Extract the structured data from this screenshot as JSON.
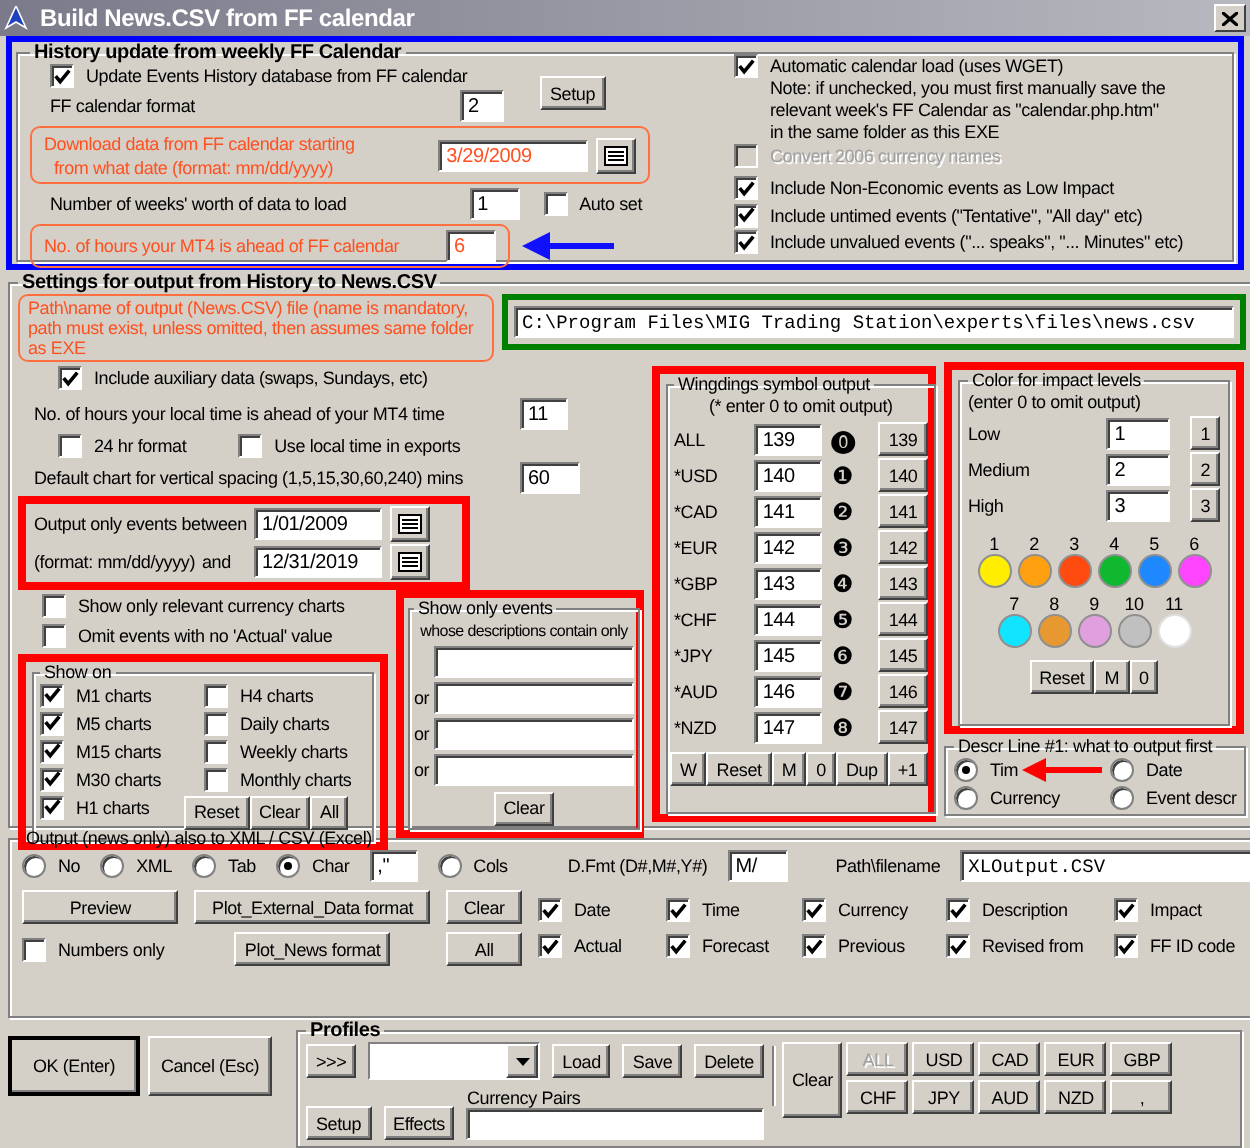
{
  "window": {
    "title": "Build News.CSV from FF calendar"
  },
  "history": {
    "title": "History update from weekly FF Calendar",
    "update_events": {
      "label": "Update Events History database from FF calendar",
      "checked": true
    },
    "setup_button": "Setup",
    "format": {
      "label": "FF calendar format",
      "value": "2"
    },
    "download": {
      "label_lines": [
        "Download data from FF calendar starting",
        "from what date (format: mm/dd/yyyy)"
      ],
      "value": "3/29/2009"
    },
    "weeks": {
      "label": "Number of weeks' worth of data to load",
      "value": "1"
    },
    "auto_set": {
      "label": "Auto set",
      "checked": false
    },
    "hours_ahead": {
      "label": "No. of hours your MT4 is ahead of FF calendar",
      "value": "6"
    },
    "auto_load": {
      "label": "Automatic calendar load  (uses WGET)",
      "checked": true
    },
    "note_lines": [
      "Note: if unchecked, you must first manually save the",
      "relevant week's FF Calendar as \"calendar.php.htm\"",
      "in the same folder as this EXE"
    ],
    "options": [
      {
        "label": "Convert 2006 currency names",
        "checked": false,
        "disabled": true
      },
      {
        "label": "Include Non-Economic events as Low Impact",
        "checked": true,
        "disabled": false
      },
      {
        "label": "Include untimed events (\"Tentative\", \"All day\" etc)",
        "checked": true,
        "disabled": false
      },
      {
        "label": "Include unvalued events (\"... speaks\", \"... Minutes\" etc)",
        "checked": true,
        "disabled": false
      }
    ]
  },
  "output_settings": {
    "title": "Settings for output from History to News.CSV",
    "path_hint": "Path\\name of output (News.CSV) file  (name is mandatory, path must exist, unless omitted, then assumes same folder as EXE",
    "path": "C:\\Program Files\\MIG Trading Station\\experts\\files\\news.csv",
    "auxiliary": {
      "label": "Include auxiliary data (swaps, Sundays, etc)",
      "checked": true
    },
    "local_hours": {
      "label": "No. of hours your local time is ahead of your MT4 time",
      "value": "11"
    },
    "format_24hr": {
      "label": "24 hr format",
      "checked": false
    },
    "local_exports": {
      "label": "Use local time in exports",
      "checked": false
    },
    "spacing": {
      "label": "Default chart for vertical spacing  (1,5,15,30,60,240)  mins",
      "value": "60"
    },
    "events_between": {
      "label_lines": [
        "Output only events between",
        "(format: mm/dd/yyyy)"
      ],
      "and_label": "and",
      "from": "1/01/2009",
      "to": "12/31/2019"
    },
    "relevant_only": {
      "label": "Show only relevant currency charts",
      "checked": false
    },
    "omit_no_actual": {
      "label": "Omit events with no 'Actual' value",
      "checked": false
    },
    "show_on": {
      "title": "Show on",
      "charts": [
        {
          "label": "M1 charts",
          "checked": true
        },
        {
          "label": "M5 charts",
          "checked": true
        },
        {
          "label": "M15 charts",
          "checked": true
        },
        {
          "label": "M30 charts",
          "checked": true
        },
        {
          "label": "H1 charts",
          "checked": true
        },
        {
          "label": "H4 charts",
          "checked": false
        },
        {
          "label": "Daily charts",
          "checked": false
        },
        {
          "label": "Weekly charts",
          "checked": false
        },
        {
          "label": "Monthly charts",
          "checked": false
        }
      ],
      "buttons": [
        "Reset",
        "Clear",
        "All"
      ]
    },
    "desc_filter": {
      "title_lines": [
        "Show only events",
        "whose descriptions contain only"
      ],
      "fields": [
        {
          "kind": "first"
        },
        {
          "kind": "or",
          "label": "or"
        },
        {
          "kind": "or",
          "label": "or"
        },
        {
          "kind": "or",
          "label": "or"
        }
      ],
      "button": "Clear"
    },
    "wingdings": {
      "title": "Wingdings symbol output",
      "note": "(* enter 0 to omit output)",
      "rows": [
        {
          "currency": "ALL",
          "value": "139",
          "glyph": "⓿",
          "button": "139"
        },
        {
          "currency": "*USD",
          "value": "140",
          "glyph": "❶",
          "button": "140"
        },
        {
          "currency": "*CAD",
          "value": "141",
          "glyph": "❷",
          "button": "141"
        },
        {
          "currency": "*EUR",
          "value": "142",
          "glyph": "❸",
          "button": "142"
        },
        {
          "currency": "*GBP",
          "value": "143",
          "glyph": "❹",
          "button": "143"
        },
        {
          "currency": "*CHF",
          "value": "144",
          "glyph": "❺",
          "button": "144"
        },
        {
          "currency": "*JPY",
          "value": "145",
          "glyph": "❻",
          "button": "145"
        },
        {
          "currency": "*AUD",
          "value": "146",
          "glyph": "❼",
          "button": "146"
        },
        {
          "currency": "*NZD",
          "value": "147",
          "glyph": "❽",
          "button": "147"
        }
      ],
      "buttons": [
        "W",
        "Reset",
        "M",
        "0",
        "Dup",
        "+1"
      ]
    },
    "impact_colors": {
      "title": "Color for impact levels",
      "note": "(enter 0 to omit output)",
      "levels": [
        {
          "label": "Low",
          "value": "1",
          "button": "1"
        },
        {
          "label": "Medium",
          "value": "2",
          "button": "2"
        },
        {
          "label": "High",
          "value": "3",
          "button": "3"
        }
      ],
      "swatches": [
        {
          "label": "1",
          "color": "#ffee00"
        },
        {
          "label": "2",
          "color": "#ffa010"
        },
        {
          "label": "3",
          "color": "#ff4a10"
        },
        {
          "label": "4",
          "color": "#10b830"
        },
        {
          "label": "5",
          "color": "#1e88ff"
        },
        {
          "label": "6",
          "color": "#ff44ff"
        },
        {
          "label": "7",
          "color": "#10e4ff"
        },
        {
          "label": "8",
          "color": "#e89830"
        },
        {
          "label": "9",
          "color": "#e0a0e0"
        },
        {
          "label": "10",
          "color": "#c0c0c0"
        },
        {
          "label": "11",
          "color": "#ffffff"
        }
      ],
      "buttons": [
        "Reset",
        "M",
        "0"
      ]
    },
    "descr_line": {
      "title": "Descr Line #1: what to output first",
      "options": [
        {
          "label": "Tim",
          "selected": true
        },
        {
          "label": "Date",
          "selected": false
        },
        {
          "label": "Currency",
          "selected": false
        },
        {
          "label": "Event descr",
          "selected": false
        }
      ]
    }
  },
  "export": {
    "title": "Output (news only) also to XML / CSV (Excel)",
    "formats": [
      {
        "label": "No",
        "selected": false
      },
      {
        "label": "XML",
        "selected": false
      },
      {
        "label": "Tab",
        "selected": false
      },
      {
        "label": "Char",
        "selected": true
      },
      {
        "label": "Cols",
        "selected": false
      }
    ],
    "char_value": ",\"",
    "date_format": {
      "label": "D.Fmt (D#,M#,Y#)",
      "value": "M/"
    },
    "path": {
      "label": "Path\\filename",
      "value": "XLOutput.CSV"
    },
    "preview_button": "Preview",
    "plot_external_button": "Plot_External_Data format",
    "clear_button": "Clear",
    "numbers_only": {
      "label": "Numbers only",
      "checked": false
    },
    "plot_news_button": "Plot_News format",
    "all_button": "All",
    "fields": [
      {
        "label": "Date",
        "checked": true
      },
      {
        "label": "Time",
        "checked": true
      },
      {
        "label": "Currency",
        "checked": true
      },
      {
        "label": "Description",
        "checked": true
      },
      {
        "label": "Impact",
        "checked": true
      },
      {
        "label": "Actual",
        "checked": true
      },
      {
        "label": "Forecast",
        "checked": true
      },
      {
        "label": "Previous",
        "checked": true
      },
      {
        "label": "Revised from",
        "checked": true
      },
      {
        "label": "FF ID code",
        "checked": true
      }
    ]
  },
  "footer": {
    "ok_button": "OK (Enter)",
    "cancel_button": "Cancel (Esc)",
    "profiles": {
      "title": "Profiles",
      "expand_button": ">>>",
      "load_button": "Load",
      "save_button": "Save",
      "delete_button": "Delete",
      "clear_button": "Clear",
      "currencies": [
        {
          "label": "ALL",
          "disabled": true
        },
        {
          "label": "USD",
          "disabled": false
        },
        {
          "label": "CAD",
          "disabled": false
        },
        {
          "label": "EUR",
          "disabled": false
        },
        {
          "label": "GBP",
          "disabled": false
        },
        {
          "label": "CHF",
          "disabled": false
        },
        {
          "label": "JPY",
          "disabled": false
        },
        {
          "label": "AUD",
          "disabled": false
        },
        {
          "label": "NZD",
          "disabled": false
        },
        {
          "label": ",",
          "disabled": false
        }
      ],
      "setup_button": "Setup",
      "effects_button": "Effects",
      "pairs_label": "Currency Pairs"
    }
  }
}
